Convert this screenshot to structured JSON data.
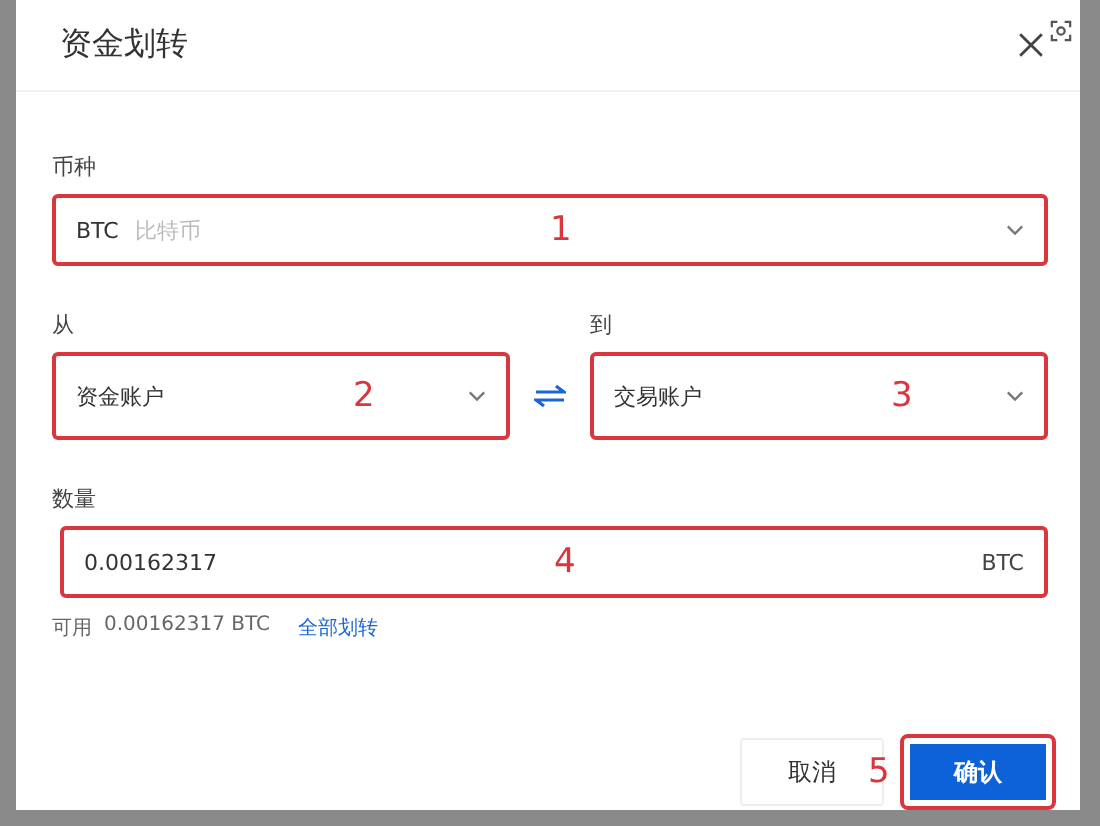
{
  "dialog": {
    "title": "资金划转"
  },
  "coin": {
    "label": "币种",
    "value": "BTC",
    "name": "比特币",
    "annotation": "1"
  },
  "from": {
    "label": "从",
    "value": "资金账户",
    "annotation": "2"
  },
  "to": {
    "label": "到",
    "value": "交易账户",
    "annotation": "3"
  },
  "amount": {
    "label": "数量",
    "value": "0.00162317",
    "unit": "BTC",
    "annotation": "4"
  },
  "available": {
    "label": "可用",
    "value": "0.00162317 BTC",
    "link": "全部划转"
  },
  "buttons": [
    {
      "label": "取消",
      "kind": "secondary"
    },
    {
      "label": "确认",
      "kind": "primary",
      "annotation": "5"
    }
  ]
}
